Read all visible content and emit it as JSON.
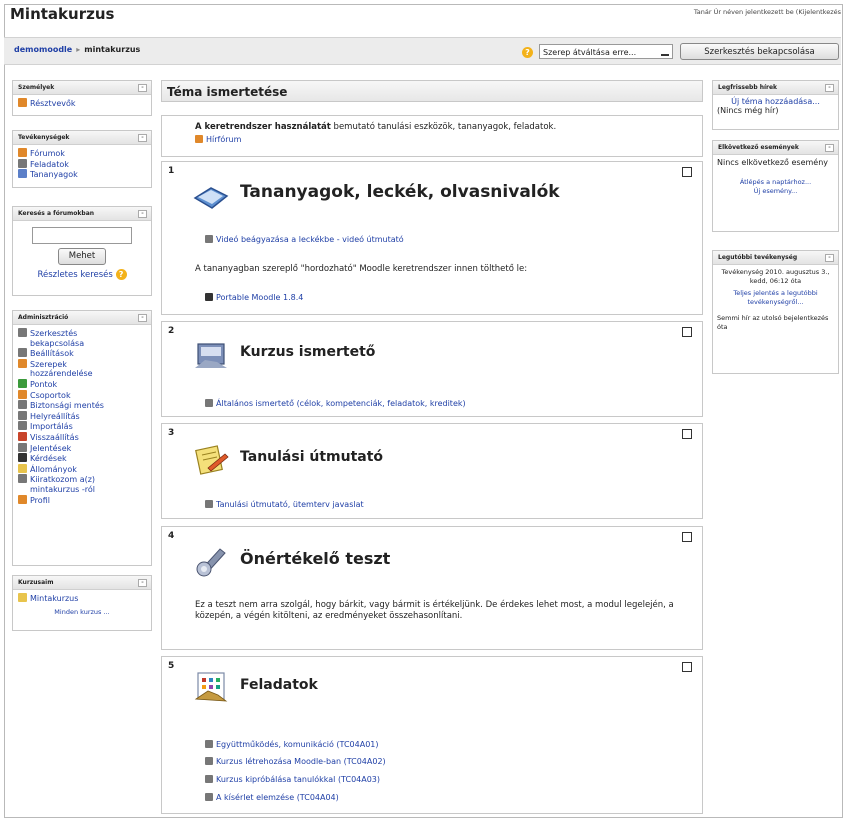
{
  "header": {
    "site_title": "Mintakurzus",
    "login_info": "Tanár Úr néven jelentkezett be (Kijelentkezés"
  },
  "navbar": {
    "breadcrumb_home": "demomoodle",
    "breadcrumb_separator": "▸",
    "breadcrumb_current": "mintakurzus",
    "role_select_value": "Szerep átváltása erre...",
    "edit_button": "Szerkesztés bekapcsolása"
  },
  "left": {
    "people": {
      "title": "Személyek",
      "items": [
        "Résztvevők"
      ]
    },
    "activities": {
      "title": "Tevékenységek",
      "items": [
        "Fórumok",
        "Feladatok",
        "Tananyagok"
      ]
    },
    "search": {
      "title": "Keresés a fórumokban",
      "button": "Mehet",
      "advanced": "Részletes keresés"
    },
    "admin": {
      "title": "Adminisztráció",
      "items": [
        "Szerkesztés",
        "bekapcsolása",
        "Beállítások",
        "Szerepek",
        "hozzárendelése",
        "Pontok",
        "Csoportok",
        "Biztonsági mentés",
        "Helyreállítás",
        "Importálás",
        "Visszaállítás",
        "Jelentések",
        "Kérdések",
        "Állományok",
        "Kiiratkozom a(z)",
        "mintakurzus -ról",
        "Profil"
      ]
    },
    "courses": {
      "title": "Kurzusaim",
      "items": [
        "Mintakurzus"
      ],
      "all": "Minden kurzus ..."
    }
  },
  "main": {
    "heading": "Téma ismertetése",
    "intro_bold": "A keretrendszer használatát",
    "intro_text": " bemutató tanulási eszközök, tananyagok, feladatok.",
    "intro_link": "Hírfórum",
    "sections": [
      {
        "num": "1",
        "title": "Tananyagok, leckék, olvasnivalók",
        "links": [
          "Videó beágyazása a leckékbe - videó útmutató"
        ],
        "text": "A tananyagban szereplő \"hordozható\" Moodle keretrendszer innen tölthető le:",
        "links2": [
          "Portable Moodle 1.8.4"
        ]
      },
      {
        "num": "2",
        "title": "Kurzus ismertető",
        "links": [
          "Általános ismertető (célok, kompetenciák, feladatok, kreditek)"
        ]
      },
      {
        "num": "3",
        "title": "Tanulási útmutató",
        "links": [
          "Tanulási útmutató, ütemterv javaslat"
        ]
      },
      {
        "num": "4",
        "title": "Önértékelő teszt",
        "text": "Ez a teszt nem arra szolgál, hogy bárkit, vagy bármit is értékeljünk. De érdekes lehet most, a modul legelején, a közepén, a végén kitölteni, az eredményeket összehasonlítani."
      },
      {
        "num": "5",
        "title": "Feladatok",
        "links": [
          "Együttműködés, komunikáció (TC04A01)",
          "Kurzus létrehozása Moodle-ban (TC04A02)",
          "Kurzus kipróbálása tanulókkal (TC04A03)",
          "A kísérlet elemzése (TC04A04)"
        ]
      }
    ]
  },
  "right": {
    "news": {
      "title": "Legfrissebb hírek",
      "add": "Új téma hozzáadása...",
      "none": "(Nincs még hír)"
    },
    "events": {
      "title": "Elkövetkező események",
      "none": "Nincs elkövetkező esemény",
      "calendar": "Átlépés a naptárhoz...",
      "new": "Új esemény..."
    },
    "recent": {
      "title": "Legutóbbi tevékenység",
      "since": "Tevékenység 2010. augusztus 3., kedd, 06:12 óta",
      "full": "Teljes jelentés a legutóbbi tevékenységről...",
      "nothing": "Semmi hír az utolsó bejelentkezés óta"
    }
  }
}
